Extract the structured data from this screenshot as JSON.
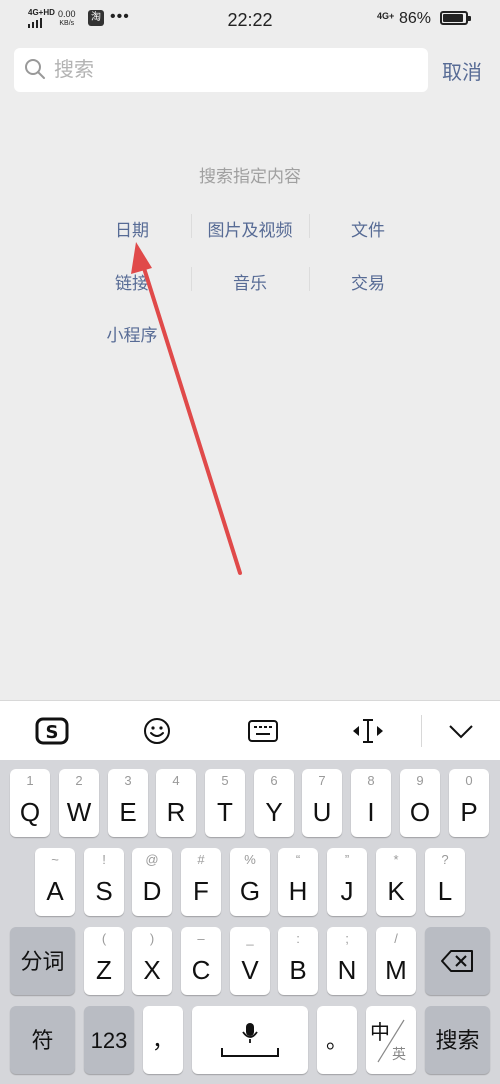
{
  "status_bar": {
    "network_left": "4G+HD",
    "speed_value": "0.00",
    "speed_unit": "KB/s",
    "app_badge": "淘",
    "dots": "•••",
    "time": "22:22",
    "network_right": "4G+",
    "battery": "86%"
  },
  "search": {
    "placeholder": "搜索",
    "cancel_label": "取消"
  },
  "content": {
    "hint": "搜索指定内容",
    "categories": [
      "日期",
      "图片及视频",
      "文件",
      "链接",
      "音乐",
      "交易",
      "小程序"
    ]
  },
  "keyboard": {
    "toolbar_icons": [
      "sogou-logo-icon",
      "emoji-icon",
      "keyboard-icon",
      "cursor-icon",
      "collapse-icon"
    ],
    "row1": [
      {
        "sub": "1",
        "main": "Q"
      },
      {
        "sub": "2",
        "main": "W"
      },
      {
        "sub": "3",
        "main": "E"
      },
      {
        "sub": "4",
        "main": "R"
      },
      {
        "sub": "5",
        "main": "T"
      },
      {
        "sub": "6",
        "main": "Y"
      },
      {
        "sub": "7",
        "main": "U"
      },
      {
        "sub": "8",
        "main": "I"
      },
      {
        "sub": "9",
        "main": "O"
      },
      {
        "sub": "0",
        "main": "P"
      }
    ],
    "row2": [
      {
        "sub": "~",
        "main": "A"
      },
      {
        "sub": "!",
        "main": "S"
      },
      {
        "sub": "@",
        "main": "D"
      },
      {
        "sub": "#",
        "main": "F"
      },
      {
        "sub": "%",
        "main": "G"
      },
      {
        "sub": "“",
        "main": "H"
      },
      {
        "sub": "”",
        "main": "J"
      },
      {
        "sub": "*",
        "main": "K"
      },
      {
        "sub": "?",
        "main": "L"
      }
    ],
    "row3_left": "分词",
    "row3": [
      {
        "sub": "(",
        "main": "Z"
      },
      {
        "sub": ")",
        "main": "X"
      },
      {
        "sub": "–",
        "main": "C"
      },
      {
        "sub": "_",
        "main": "V"
      },
      {
        "sub": ":",
        "main": "B"
      },
      {
        "sub": ";",
        "main": "N"
      },
      {
        "sub": "/",
        "main": "M"
      }
    ],
    "row4": {
      "symbols": "符",
      "numbers": "123",
      "comma": "，",
      "period": "。",
      "lang": "中",
      "lang_sub": "英",
      "search": "搜索"
    }
  },
  "colors": {
    "accent": "#576b95",
    "arrow": "#e04a4a"
  }
}
